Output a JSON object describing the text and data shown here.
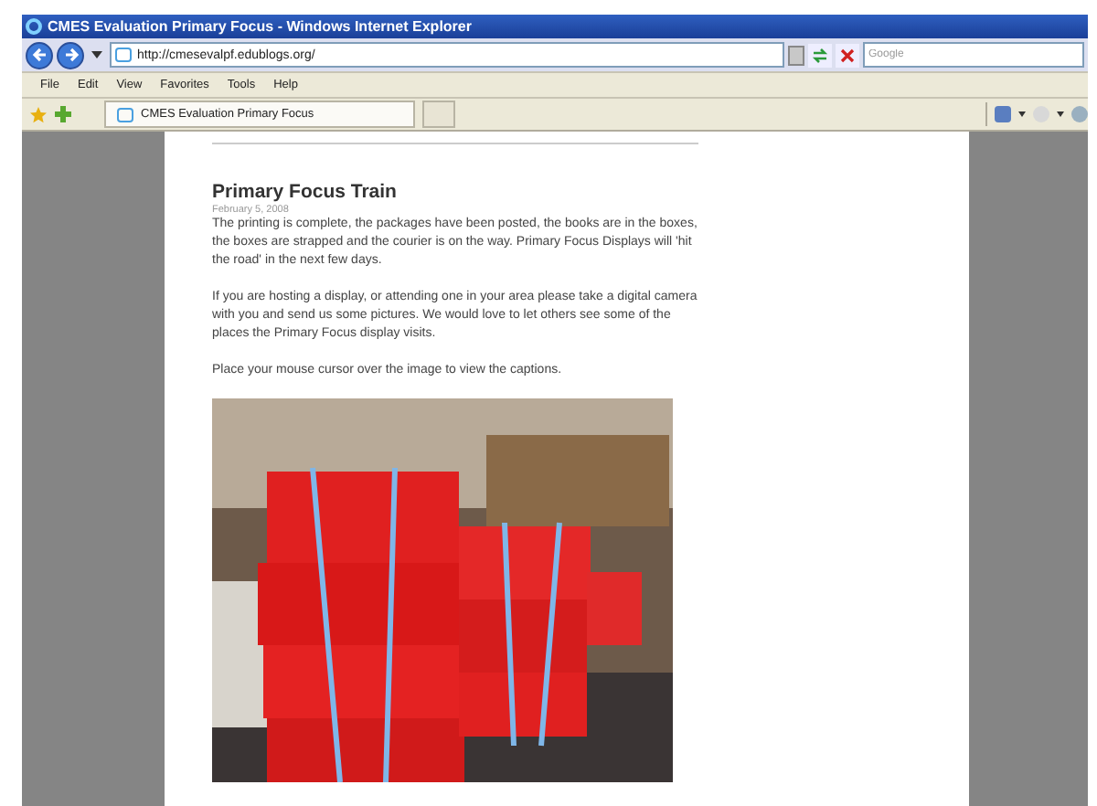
{
  "window": {
    "title": "CMES Evaluation Primary Focus - Windows Internet Explorer"
  },
  "address_bar": {
    "value": "http://cmesevalpf.edublogs.org/"
  },
  "search": {
    "placeholder": "Google"
  },
  "menu": [
    "File",
    "Edit",
    "View",
    "Favorites",
    "Tools",
    "Help"
  ],
  "tabs": [
    {
      "label": "CMES Evaluation Primary Focus",
      "selected": true
    }
  ],
  "post": {
    "title": "Primary Focus Train",
    "date": "February 5, 2008",
    "paragraphs": [
      "The printing is complete, the packages have been posted, the books are in the boxes, the boxes are strapped and the courier is on the way. Primary Focus Displays will 'hit the road' in the next few days.",
      "If you are hosting a display, or attending one in your area please take a digital camera with you and send us some pictures. We would love to let others see some of the places the Primary Focus display visits.",
      "Place your mouse cursor over the image to view the captions."
    ]
  }
}
